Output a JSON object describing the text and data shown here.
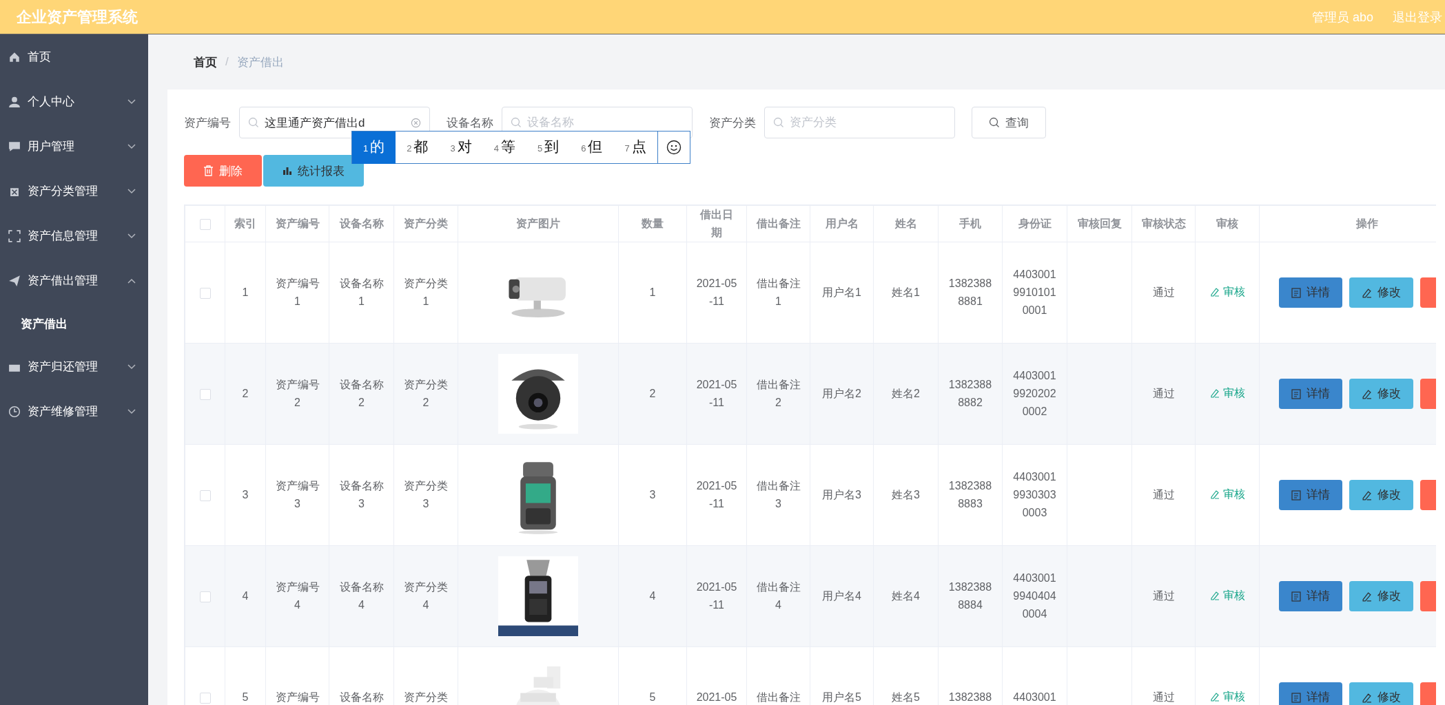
{
  "header": {
    "title": "企业资产管理系统",
    "user": "管理员 abo",
    "logout": "退出登录"
  },
  "sidebar": {
    "items": [
      {
        "label": "首页",
        "kind": "link",
        "selected": false
      },
      {
        "label": "个人中心",
        "kind": "submenu",
        "expanded": false
      },
      {
        "label": "用户管理",
        "kind": "submenu",
        "expanded": false
      },
      {
        "label": "资产分类管理",
        "kind": "submenu",
        "expanded": false
      },
      {
        "label": "资产信息管理",
        "kind": "submenu",
        "expanded": false
      },
      {
        "label": "资产借出管理",
        "kind": "submenu",
        "expanded": true,
        "children": [
          {
            "label": "资产借出",
            "selected": true
          }
        ]
      },
      {
        "label": "资产归还管理",
        "kind": "submenu",
        "expanded": false
      },
      {
        "label": "资产维修管理",
        "kind": "submenu",
        "expanded": false
      }
    ]
  },
  "breadcrumb": {
    "separator": "/",
    "items": [
      {
        "label": "首页"
      },
      {
        "label": "资产借出"
      }
    ]
  },
  "search": {
    "fields": [
      {
        "label": "资产编号",
        "value": "这里通产资产借出d"
      },
      {
        "label": "设备名称",
        "placeholder": "设备名称"
      },
      {
        "label": "资产分类",
        "placeholder": "资产分类"
      }
    ],
    "button": "查询"
  },
  "ime": {
    "candidates": [
      {
        "number": "1",
        "text": "的",
        "selected": true
      },
      {
        "number": "2",
        "text": "都",
        "selected": false
      },
      {
        "number": "3",
        "text": "对",
        "selected": false
      },
      {
        "number": "4",
        "text": "等",
        "selected": false
      },
      {
        "number": "5",
        "text": "到",
        "selected": false
      },
      {
        "number": "6",
        "text": "但",
        "selected": false
      },
      {
        "number": "7",
        "text": "点",
        "selected": false
      }
    ]
  },
  "actions": [
    {
      "label": "删除",
      "kind": "danger"
    },
    {
      "label": "统计报表",
      "kind": "report"
    }
  ],
  "table": {
    "select_all": {
      "checked": false
    },
    "columns": [
      "索引",
      "资产编号",
      "设备名称",
      "资产分类",
      "资产图片",
      "数量",
      "借出日期",
      "借出备注",
      "用户名",
      "姓名",
      "手机",
      "身份证",
      "审核回复",
      "审核状态",
      "审核",
      "操作"
    ],
    "rows": [
      {
        "checked": false,
        "index": "1",
        "asset_code": "资产编号1",
        "device": "设备名称1",
        "category": "资产分类1",
        "image": {
          "kind": "picture"
        },
        "quantity": "1",
        "date": "2021-05-11",
        "note": "借出备注1",
        "username": "用户名1",
        "name": "姓名1",
        "phone": "13823888881",
        "id_card": "440300199101010001",
        "status": "通过",
        "review": "审核",
        "buttons": [
          "详情",
          "修改"
        ]
      },
      {
        "checked": false,
        "index": "2",
        "asset_code": "资产编号2",
        "device": "设备名称2",
        "category": "资产分类2",
        "image": {
          "kind": "picture"
        },
        "quantity": "2",
        "date": "2021-05-11",
        "note": "借出备注2",
        "username": "用户名2",
        "name": "姓名2",
        "phone": "13823888882",
        "id_card": "440300199202020002",
        "status": "通过",
        "review": "审核",
        "buttons": [
          "详情",
          "修改"
        ]
      },
      {
        "checked": false,
        "index": "3",
        "asset_code": "资产编号3",
        "device": "设备名称3",
        "category": "资产分类3",
        "image": {
          "kind": "picture"
        },
        "quantity": "3",
        "date": "2021-05-11",
        "note": "借出备注3",
        "username": "用户名3",
        "name": "姓名3",
        "phone": "13823888883",
        "id_card": "440300199303030003",
        "status": "通过",
        "review": "审核",
        "buttons": [
          "详情",
          "修改"
        ]
      },
      {
        "checked": false,
        "index": "4",
        "asset_code": "资产编号4",
        "device": "设备名称4",
        "category": "资产分类4",
        "image": {
          "kind": "picture"
        },
        "quantity": "4",
        "date": "2021-05-11",
        "note": "借出备注4",
        "username": "用户名4",
        "name": "姓名4",
        "phone": "13823888884",
        "id_card": "440300199404040004",
        "status": "通过",
        "review": "审核",
        "buttons": [
          "详情",
          "修改"
        ]
      },
      {
        "checked": false,
        "index": "5",
        "asset_code": "资产编号",
        "device": "设备名称",
        "category": "资产分类",
        "image": {
          "kind": "picture"
        },
        "quantity": "5",
        "date": "2021-05",
        "note": "借出备注",
        "username": "用户名5",
        "name": "姓名5",
        "phone": "1382388",
        "id_card": "4403001",
        "status": "通过",
        "review": "审核",
        "buttons": [
          "详情",
          "修改"
        ]
      }
    ]
  }
}
